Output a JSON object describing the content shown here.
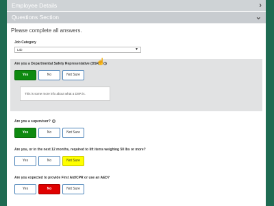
{
  "sections": {
    "employee_details": "Employee Details",
    "questions_section": "Questions Section"
  },
  "intro_text": "Please complete all answers.",
  "job_category": {
    "label": "Job Category",
    "value": "Lab"
  },
  "questions": [
    {
      "text": "Are you a Departmental Safety Representative (DSR)?",
      "has_help": true,
      "options": [
        "Yes",
        "No",
        "Not Sure"
      ],
      "selected": "Yes",
      "info_text": "This is some more info about what a DSR is."
    },
    {
      "text": "Are you a supervisor?",
      "has_help": true,
      "options": [
        "Yes",
        "No",
        "Not Sure"
      ],
      "selected": "Yes"
    },
    {
      "text": "Are you, or in the next 12 months, required to lift items weighing 50 lbs or more?",
      "has_help": false,
      "options": [
        "Yes",
        "No",
        "Not Sure"
      ],
      "selected": "Not Sure"
    },
    {
      "text": "Are you expected to provide First Aid/CPR or use an AED?",
      "has_help": false,
      "options": [
        "Yes",
        "No",
        "Not Sure"
      ],
      "selected": "No"
    }
  ],
  "colors": {
    "yes_selected": "#0e8a10",
    "no_selected": "#e00000",
    "notsure_selected": "#ffff00",
    "background": "#1f6b52"
  }
}
